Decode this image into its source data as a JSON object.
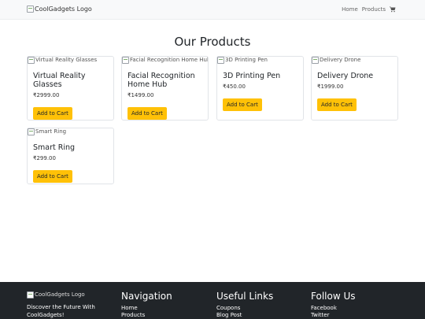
{
  "header": {
    "logo_alt": "CoolGadgets Logo",
    "nav": [
      "Home",
      "Products"
    ],
    "cart_icon": "shopping-cart-icon"
  },
  "main": {
    "title": "Our Products",
    "products": [
      {
        "image_alt": "Virtual Reality Glasses",
        "name": "Virtual Reality Glasses",
        "price": "₹2999.00",
        "button": "Add to Cart"
      },
      {
        "image_alt": "Facial Recognition Home Hub",
        "name": "Facial Recognition Home Hub",
        "price": "₹1499.00",
        "button": "Add to Cart"
      },
      {
        "image_alt": "3D Printing Pen",
        "name": "3D Printing Pen",
        "price": "₹450.00",
        "button": "Add to Cart"
      },
      {
        "image_alt": "Delivery Drone",
        "name": "Delivery Drone",
        "price": "₹1999.00",
        "button": "Add to Cart"
      },
      {
        "image_alt": "Smart Ring",
        "name": "Smart Ring",
        "price": "₹299.00",
        "button": "Add to Cart"
      }
    ]
  },
  "footer": {
    "logo_alt": "CoolGadgets Logo",
    "tagline": "Discover the Future With CoolGadgets!",
    "columns": [
      {
        "title": "Navigation",
        "links": [
          "Home",
          "Products"
        ]
      },
      {
        "title": "Useful Links",
        "links": [
          "Coupons",
          "Blog Post"
        ]
      },
      {
        "title": "Follow Us",
        "links": [
          "Facebook",
          "Twitter"
        ]
      }
    ]
  },
  "colors": {
    "button_bg": "#ffc107",
    "footer_bg": "#212529",
    "navbar_bg": "#f8f9fa"
  }
}
